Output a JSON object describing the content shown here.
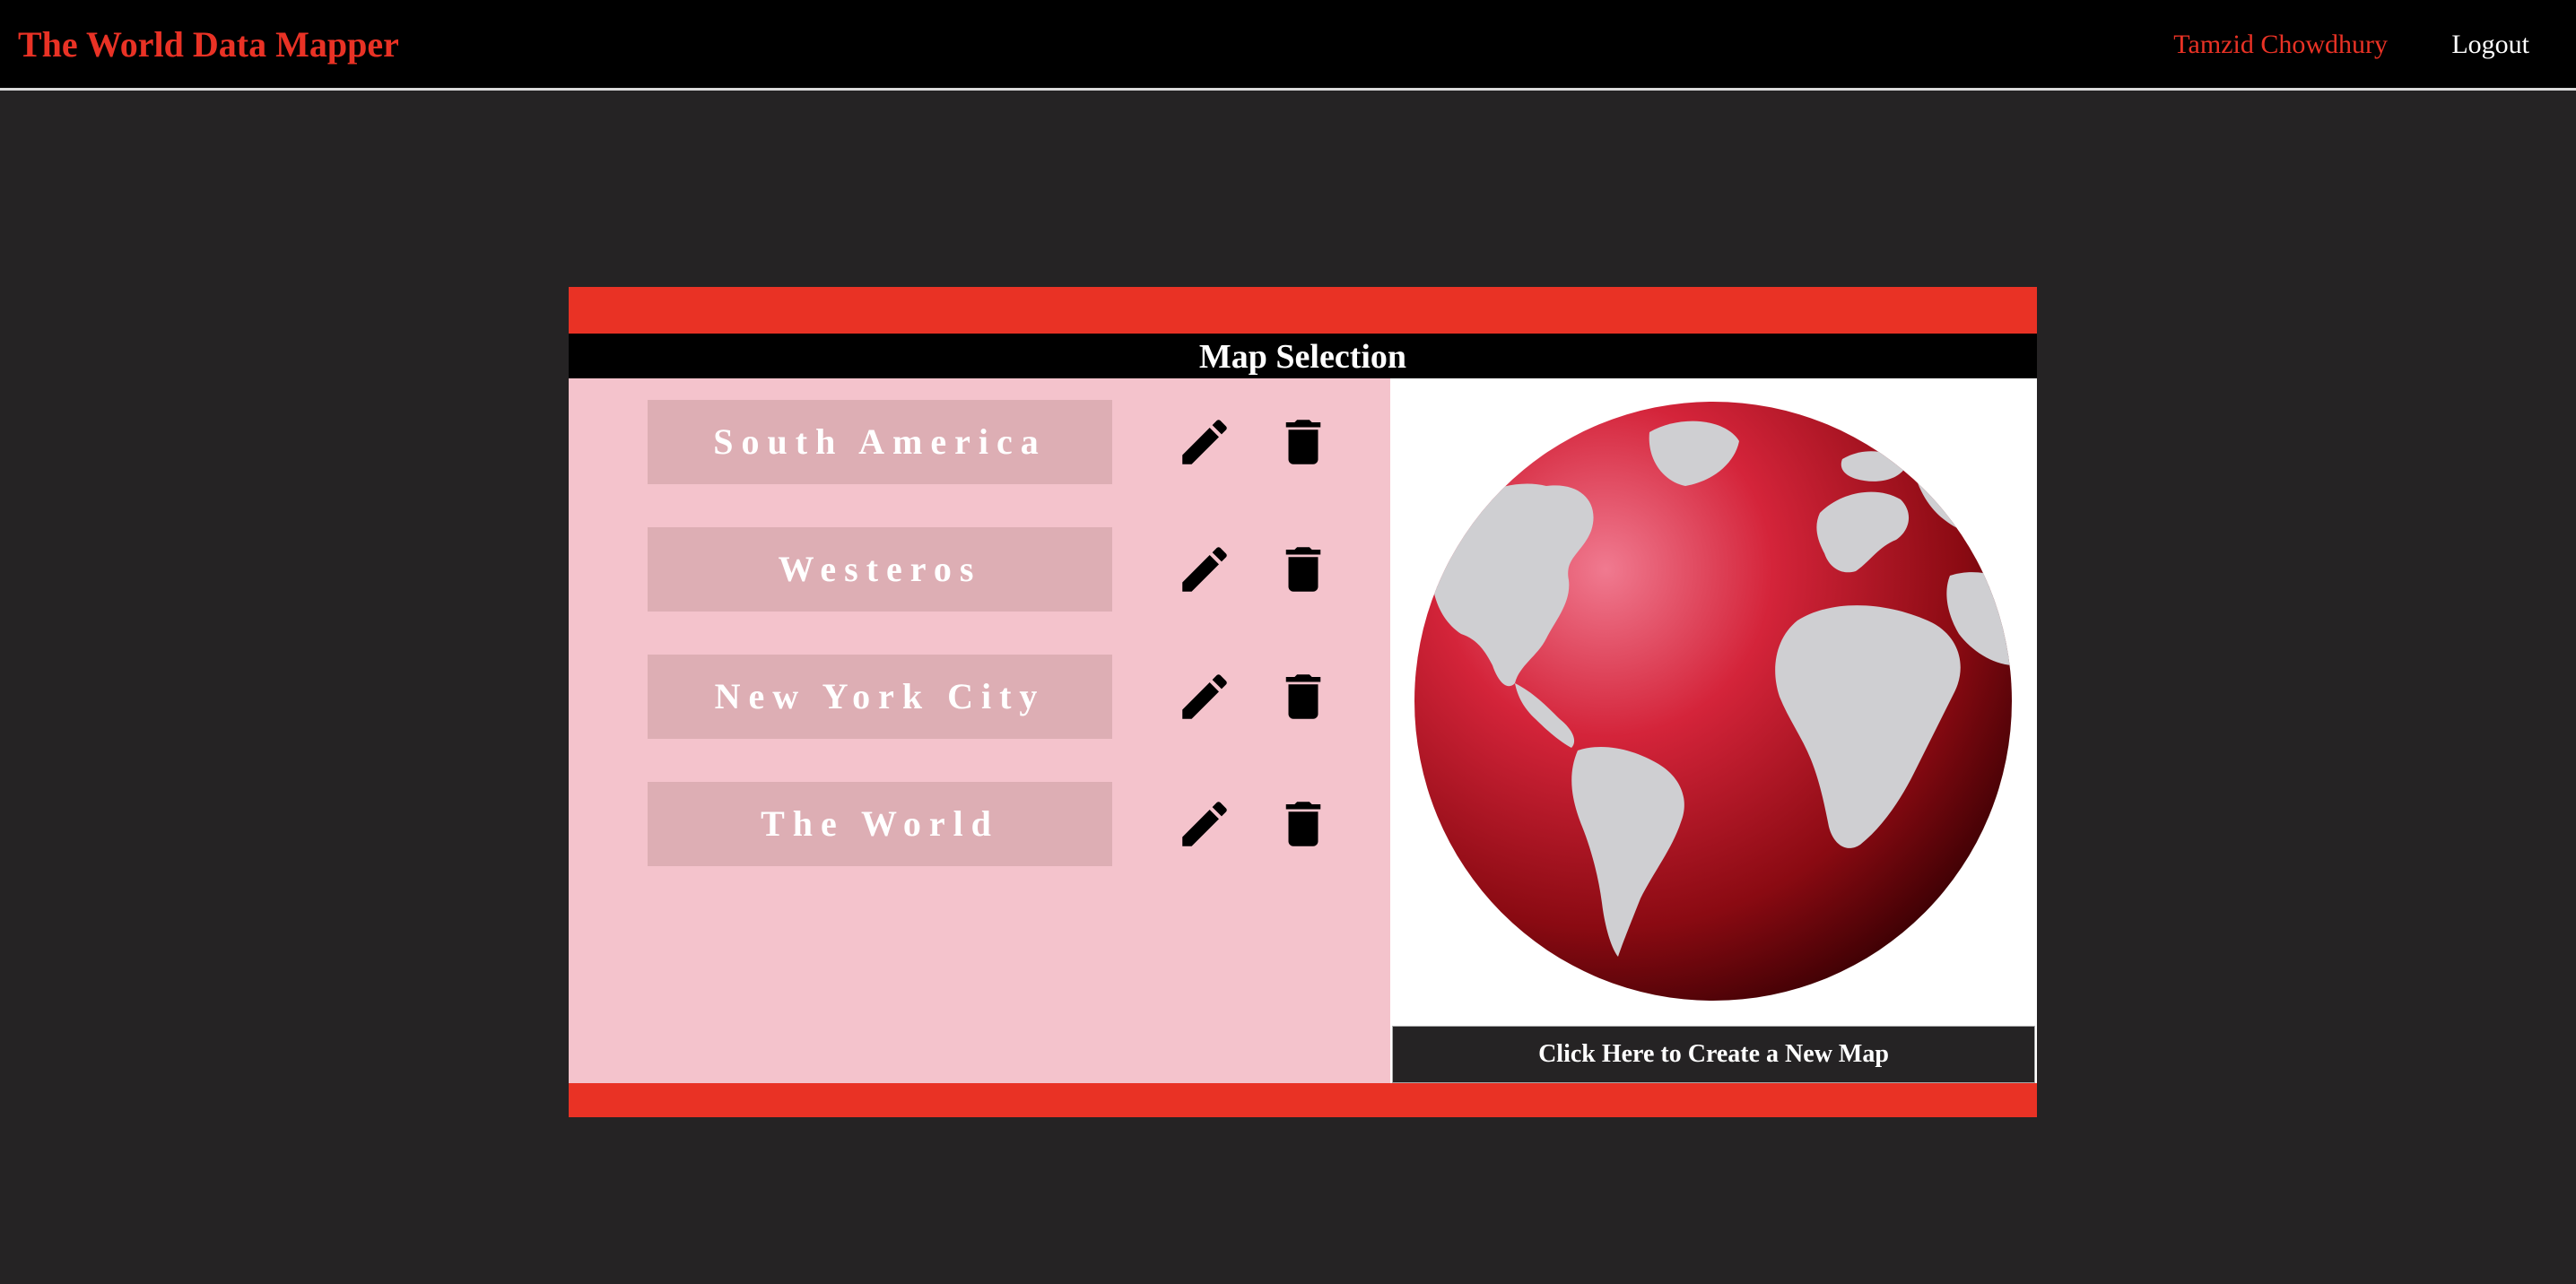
{
  "colors": {
    "brand_red": "#e93225",
    "list_bg": "#f4c3cc",
    "item_bg": "#ddaeb4",
    "page_bg": "#252324",
    "nav_bg": "#000000"
  },
  "navbar": {
    "app_title": "The World Data Mapper",
    "user_name": "Tamzid Chowdhury",
    "logout_label": "Logout"
  },
  "panel": {
    "title": "Map Selection",
    "maps": [
      {
        "name": "South America"
      },
      {
        "name": "Westeros"
      },
      {
        "name": "New York City"
      },
      {
        "name": "The World"
      }
    ],
    "icons": {
      "edit": "pencil-icon",
      "delete": "trash-icon"
    },
    "preview_image": "globe-image",
    "create_label": "Click Here to Create a New Map"
  }
}
